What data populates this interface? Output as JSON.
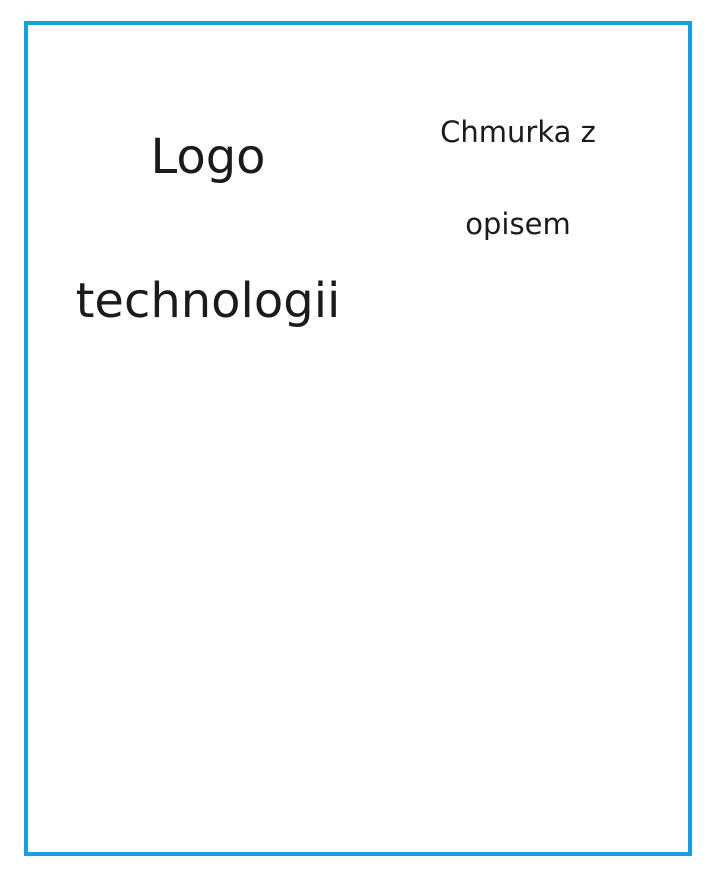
{
  "logo_placeholder": {
    "line1": "Logo",
    "line2": "technologii"
  },
  "tooltip_placeholder": {
    "line1": "Chmurka z",
    "line2": "opisem"
  },
  "colors": {
    "frame_border": "#1a9ee0",
    "text": "#1b1b1b",
    "background": "#ffffff"
  }
}
